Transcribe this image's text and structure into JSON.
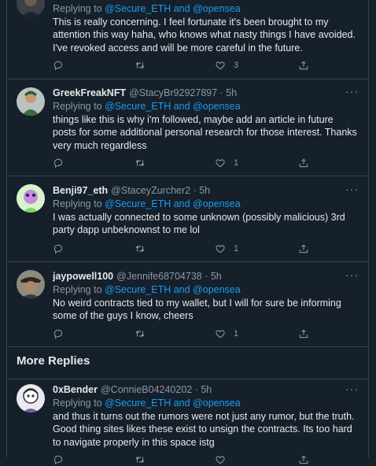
{
  "icons": {
    "reply": "reply-icon",
    "retweet": "retweet-icon",
    "like": "heart-icon",
    "share": "share-icon",
    "more": "more-icon"
  },
  "colors": {
    "background": "#15202b",
    "text": "#e7e9ea",
    "muted": "#8b98a5",
    "link": "#1d9bf0",
    "border": "#38444d"
  },
  "tweets": [
    {
      "replying_prefix": "Replying to ",
      "replying_targets": "@Secure_ETH and @opensea",
      "text": "This is really concerning. I feel fortunate it's been brought to my attention this way haha, who knows what nasty things I have avoided. I've revoked access and will be more careful in the future.",
      "likes": "3"
    },
    {
      "name": "GreekFreakNFT",
      "handle_time": "@StacyBr92927897 · 5h",
      "replying_prefix": "Replying to ",
      "replying_targets": "@Secure_ETH and @opensea",
      "text": "things like this is why i'm followed, maybe add an article in future posts for some additional personal research for those interest. Thanks very much regardless",
      "likes": "1"
    },
    {
      "name": "Benji97_eth",
      "handle_time": "@StaceyZurcher2 · 5h",
      "replying_prefix": "Replying to ",
      "replying_targets": "@Secure_ETH and @opensea",
      "text": "I was actually connected to some unknown (possibly malicious) 3rd party dapp unbeknownst to me lol",
      "likes": "1"
    },
    {
      "name": "jaypowell100",
      "handle_time": "@Jennife68704738 · 5h",
      "replying_prefix": "Replying to ",
      "replying_targets": "@Secure_ETH and @opensea",
      "text": "No weird contracts tied to my wallet, but I will for sure be informing some of the guys I know, cheers",
      "likes": "1"
    },
    {
      "name": "0xBender",
      "handle_time": "@ConnieB04240202 · 5h",
      "replying_prefix": "Replying to ",
      "replying_targets": "@Secure_ETH and @opensea",
      "text": "and thus it turns out the rumors were not just any rumor, but the truth. Good thing sites likes these exist to unsign the contracts. Its too hard to navigate properly in this space istg"
    }
  ],
  "more_replies": "More Replies"
}
